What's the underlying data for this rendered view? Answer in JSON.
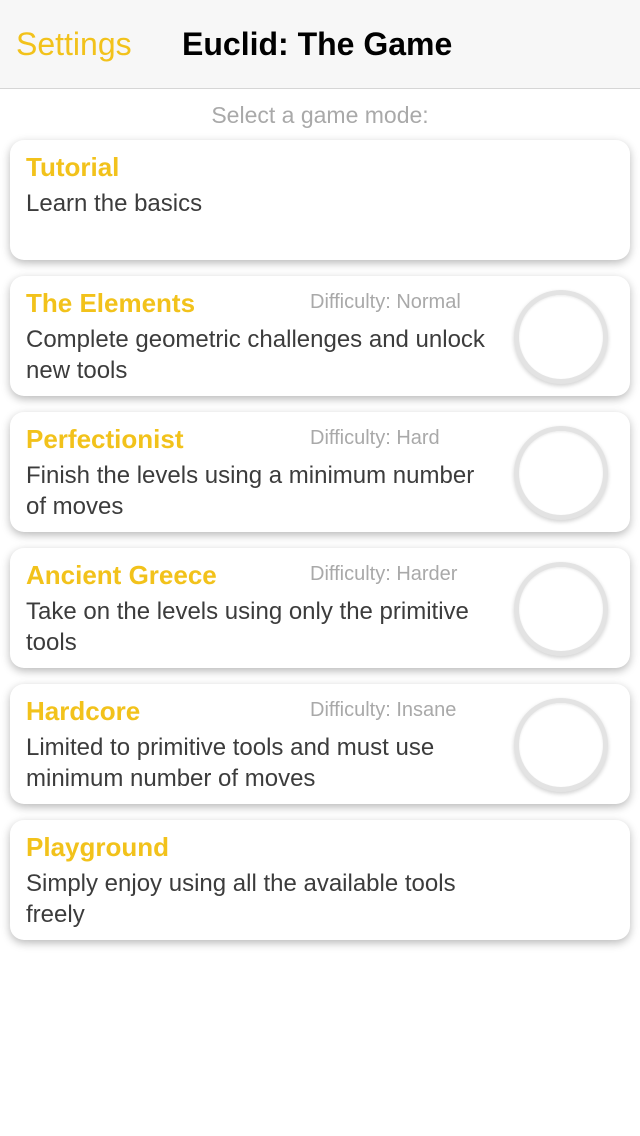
{
  "nav": {
    "back_label": "Settings",
    "title": "Euclid: The Game"
  },
  "subtitle": "Select a game mode:",
  "colors": {
    "accent": "#f2c21b",
    "muted": "#a9a9a9",
    "text": "#3c3c3c"
  },
  "modes": [
    {
      "title": "Tutorial",
      "difficulty": "",
      "description": "Learn the basics"
    },
    {
      "title": "The Elements",
      "difficulty": "Difficulty: Normal",
      "description": "Complete geometric challenges and unlock new tools"
    },
    {
      "title": "Perfectionist",
      "difficulty": "Difficulty: Hard",
      "description": "Finish the levels using a minimum number of moves"
    },
    {
      "title": "Ancient Greece",
      "difficulty": "Difficulty: Harder",
      "description": "Take on the levels using only the primitive tools"
    },
    {
      "title": "Hardcore",
      "difficulty": "Difficulty: Insane",
      "description": "Limited to primitive tools and must use minimum number of moves"
    },
    {
      "title": "Playground",
      "difficulty": "",
      "description": "Simply enjoy using all the available tools freely"
    }
  ]
}
